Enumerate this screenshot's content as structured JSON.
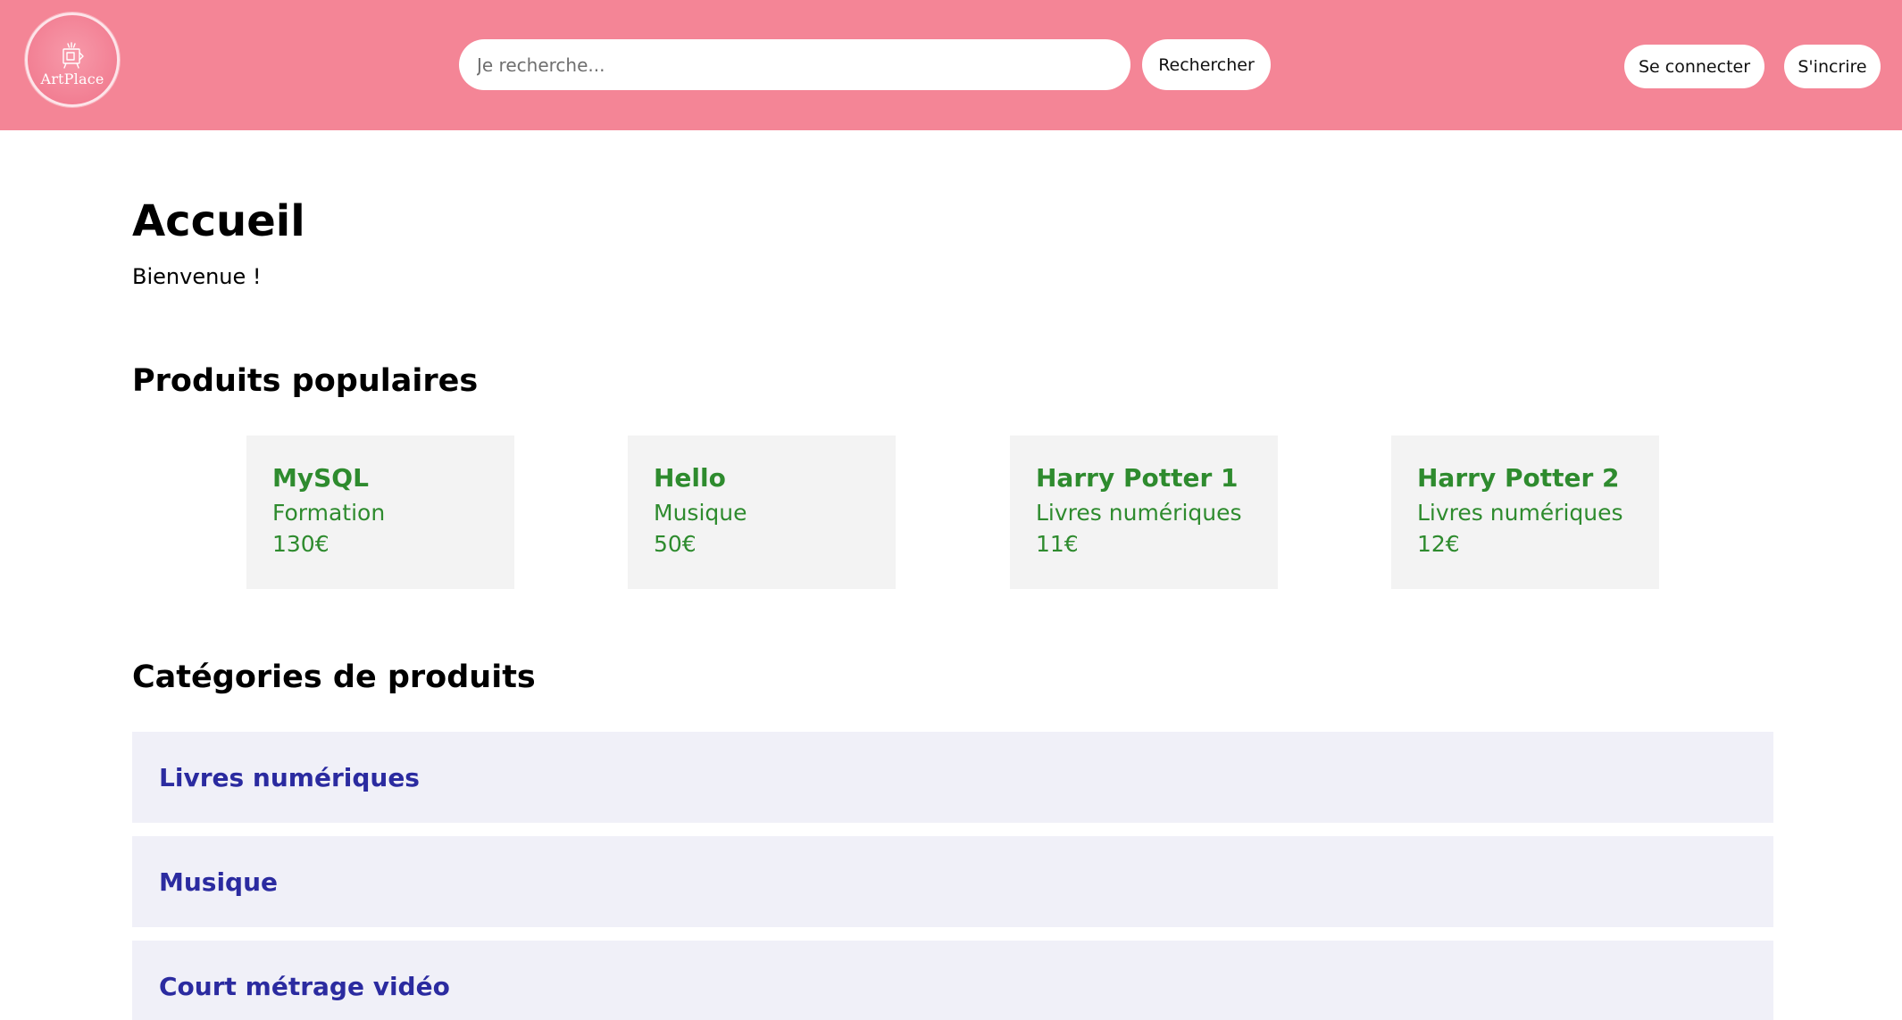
{
  "header": {
    "logo_text": "ArtPlace",
    "search_placeholder": "Je recherche...",
    "search_button": "Rechercher",
    "login_button": "Se connecter",
    "signup_button": "S'incrire",
    "background_color": "#f48596"
  },
  "main": {
    "title": "Accueil",
    "welcome": "Bienvenue !",
    "popular_title": "Produits populaires",
    "products": [
      {
        "name": "MySQL",
        "category": "Formation",
        "price": "130€"
      },
      {
        "name": "Hello",
        "category": "Musique",
        "price": "50€"
      },
      {
        "name": "Harry Potter 1",
        "category": "Livres numériques",
        "price": "11€"
      },
      {
        "name": "Harry Potter 2",
        "category": "Livres numériques",
        "price": "12€"
      }
    ],
    "categories_title": "Catégories de produits",
    "categories": [
      {
        "label": "Livres numériques"
      },
      {
        "label": "Musique"
      },
      {
        "label": "Court métrage vidéo"
      }
    ]
  },
  "colors": {
    "product_text": "#2e8b2e",
    "product_card_bg": "#f3f3f3",
    "category_text": "#2b2ba0",
    "category_bg": "#f0f0f8"
  },
  "icons": {
    "logo": "easel-icon"
  }
}
